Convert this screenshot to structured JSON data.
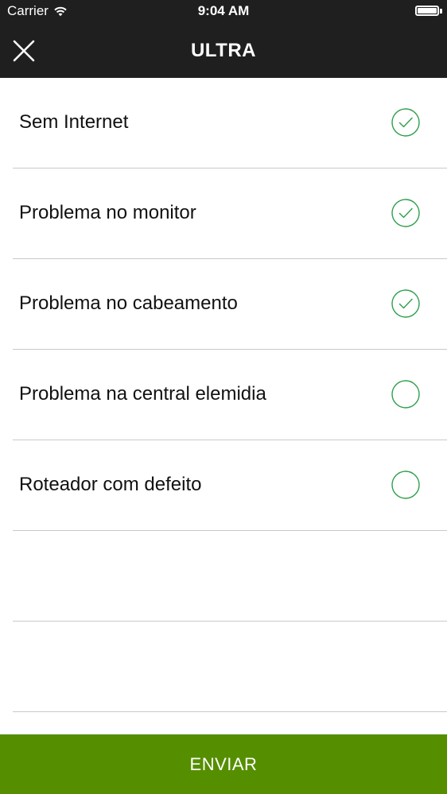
{
  "status_bar": {
    "carrier": "Carrier",
    "time": "9:04 AM",
    "wifi_icon": "wifi-icon",
    "battery_icon": "battery-icon"
  },
  "nav": {
    "title": "ULTRA",
    "close_icon": "close-icon"
  },
  "options": [
    {
      "label": "Sem Internet",
      "checked": true
    },
    {
      "label": "Problema no monitor",
      "checked": true
    },
    {
      "label": "Problema no cabeamento",
      "checked": true
    },
    {
      "label": "Problema na central elemidia",
      "checked": false
    },
    {
      "label": "Roteador com defeito",
      "checked": false
    }
  ],
  "submit": {
    "label": "ENVIAR"
  },
  "colors": {
    "nav_background": "#1f1f1f",
    "accent_green": "#558f00",
    "check_green": "#2e9e4a",
    "divider": "#c9c9c9"
  }
}
